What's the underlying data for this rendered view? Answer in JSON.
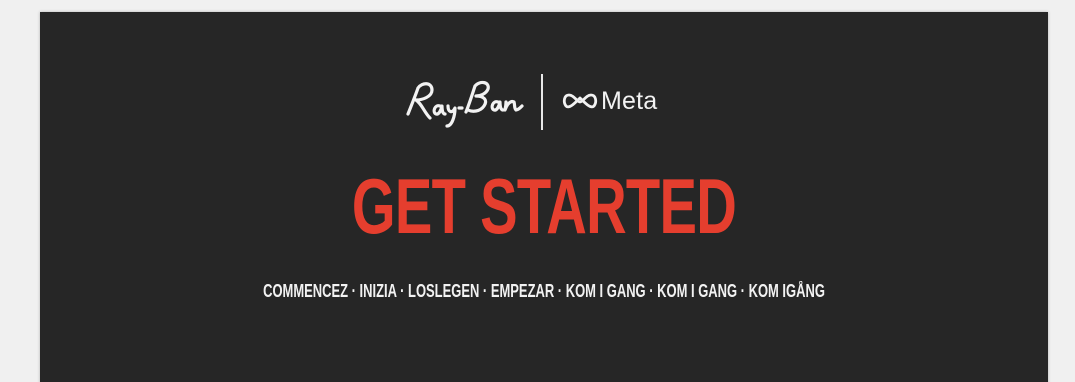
{
  "brand": {
    "rayban_wordmark": "Ray-Ban",
    "meta_wordmark": "Meta",
    "meta_symbol_icon": "infinity-meta-icon"
  },
  "headline": "GET STARTED",
  "subheadline": "COMMENCEZ · INIZIA · LOSLEGEN · EMPEZAR · KOM I GANG · KOM I GANG · KOM IGÅNG",
  "colors": {
    "background": "#262626",
    "accent": "#e53e2e",
    "text": "#f2f2f2"
  }
}
